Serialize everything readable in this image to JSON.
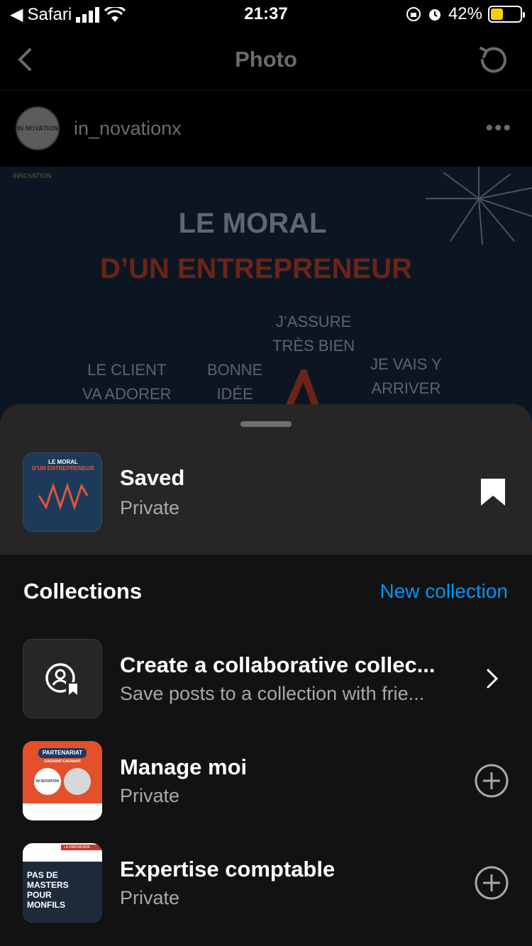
{
  "status_bar": {
    "back_app": "Safari",
    "time": "21:37",
    "battery": "42%",
    "battery_level": 0.42
  },
  "nav": {
    "title": "Photo"
  },
  "post": {
    "username": "in_novationx",
    "avatar_label": "IN NOVATION",
    "image": {
      "logo_text": "INNOVATION",
      "title_line1": "LE MORAL",
      "title_line2": "D’UN ENTREPRENEUR",
      "words": [
        "J’ASSURE",
        "TRÈS BIEN",
        "LE CLIENT",
        "VA ADORER",
        "BONNE",
        "IDÉE",
        "JE VAIS Y",
        "ARRIVER"
      ]
    }
  },
  "sheet": {
    "saved": {
      "title": "Saved",
      "subtitle": "Private",
      "thumb_title1": "LE MORAL",
      "thumb_title2": "D'UN ENTREPRENEUR"
    },
    "collections_heading": "Collections",
    "new_collection": "New collection",
    "items": [
      {
        "title": "Create a collaborative collec...",
        "subtitle": "Save posts to a collection with frie..."
      },
      {
        "title": "Manage moi",
        "subtitle": "Private",
        "thumb_badge": "PARTENARIAT",
        "thumb_sub": "GAGNANT-GAGNANT",
        "thumb_logo": "IN NOVATION"
      },
      {
        "title": "Expertise comptable",
        "subtitle": "Private",
        "thumb_banner": "LA PARISIENNE",
        "thumb_text": [
          "PAS DE",
          "MASTERS",
          "POUR",
          "MONFILS"
        ]
      }
    ]
  },
  "colors": {
    "accent_blue": "#0095f6",
    "sheet_top": "#262626",
    "sheet_body": "#121212",
    "dim_text": "#6b6b6b"
  },
  "icons": [
    "back-chevron-icon",
    "refresh-icon",
    "more-icon",
    "bookmark-icon",
    "collaborative-collection-icon",
    "chevron-right-icon",
    "plus-circle-icon"
  ]
}
